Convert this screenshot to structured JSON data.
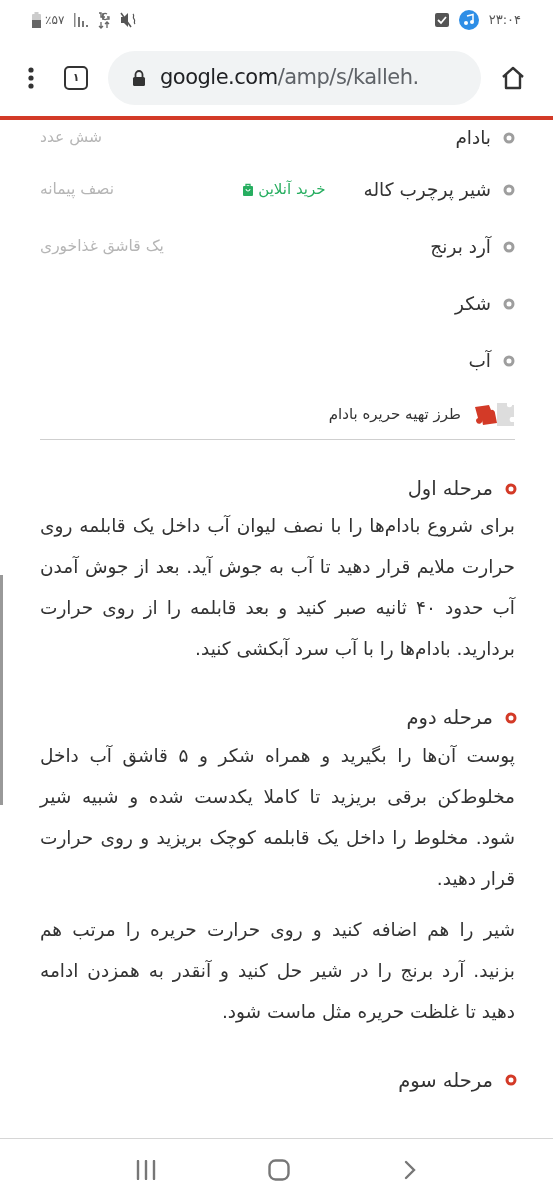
{
  "status_bar": {
    "battery": "٪۵۷",
    "time": "۲۳:۰۴"
  },
  "browser": {
    "tab_count": "۱",
    "url_host": "google.com",
    "url_path": "/amp/s/kalleh."
  },
  "ingredients": [
    {
      "name": "بادام",
      "amount": "شش عدد"
    },
    {
      "name": "شیر پرچرب کاله",
      "amount": "نصف پیمانه",
      "link": "خرید آنلاین"
    },
    {
      "name": "آرد برنج",
      "amount": "یک قاشق غذاخوری"
    },
    {
      "name": "شکر"
    },
    {
      "name": "آب"
    }
  ],
  "section_title": "طرز تهیه حریره بادام",
  "steps": [
    {
      "title": "مرحله اول",
      "paragraphs": [
        "برای شروع بادام‌ها را با نصف لیوان آب داخل یک قابلمه روی حرارت ملایم قرار دهید تا آب به جوش آید. بعد از جوش آمدن آب حدود ۴۰ ثانیه صبر کنید و بعد قابلمه را از روی حرارت بردارید. بادام‌ها را با آب سرد آبکشی کنید."
      ]
    },
    {
      "title": "مرحله دوم",
      "paragraphs": [
        "پوست آن‌ها را بگیرید و همراه شکر و ۵ قاشق آب داخل مخلوط‌کن برقی بریزید تا کاملا یکدست شده و شبیه شیر شود. مخلوط را داخل یک قابلمه کوچک بریزید و روی حرارت قرار دهید.",
        "شیر را هم اضافه کنید و روی حرارت حریره را مرتب هم بزنید. آرد برنج را در شیر حل کنید و آنقدر به همزدن ادامه دهید تا غلظت حریره مثل ماست شود."
      ]
    },
    {
      "title": "مرحله سوم"
    }
  ]
}
